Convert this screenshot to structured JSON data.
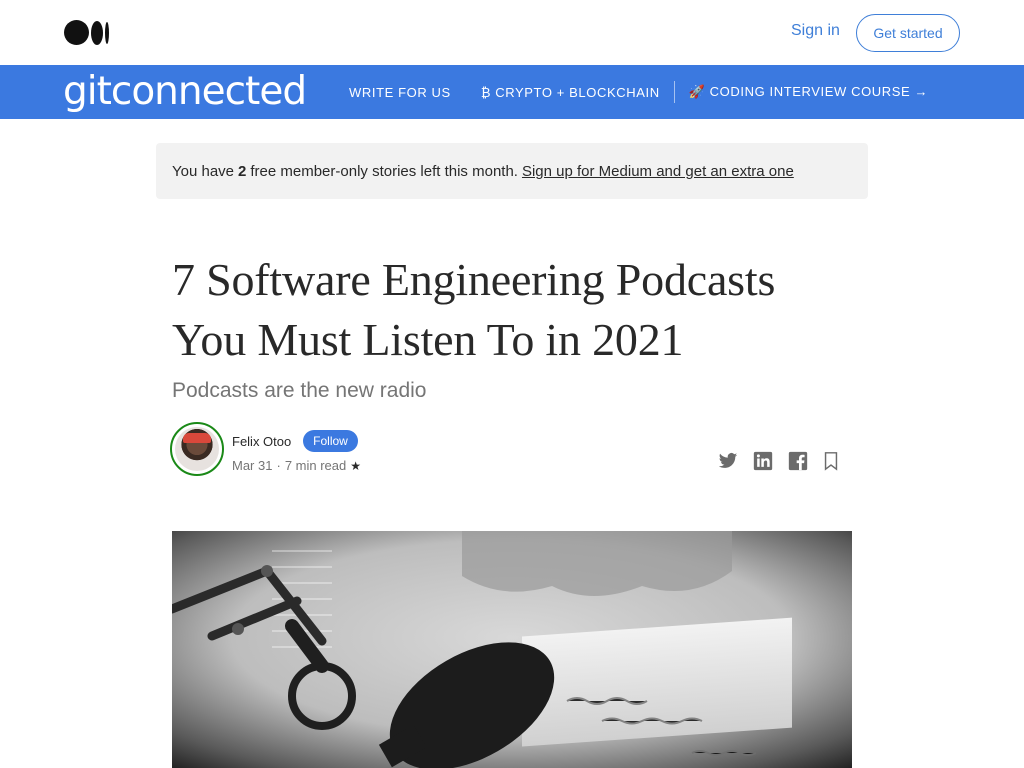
{
  "topbar": {
    "signin_label": "Sign in",
    "getstarted_label": "Get started"
  },
  "publication": {
    "logo_text": "gitconnected",
    "nav": [
      {
        "label": "WRITE FOR US"
      },
      {
        "label": "₿ CRYPTO + BLOCKCHAIN"
      },
      {
        "label": "🚀 CODING INTERVIEW COURSE →"
      }
    ]
  },
  "banner": {
    "prefix": "You have",
    "count": "2",
    "suffix": "free member-only stories left this month.",
    "link": "Sign up for Medium and get an extra one"
  },
  "article": {
    "title_line1": "7 Software Engineering Podcasts",
    "title_line2": "You Must Listen To in 2021",
    "subtitle": "Podcasts are the new radio",
    "author": "Felix Otoo",
    "follow_label": "Follow",
    "date": "Mar 31",
    "read_time": "7 min read",
    "member_star": "★"
  },
  "icons": {
    "share": [
      "twitter-icon",
      "linkedin-icon",
      "facebook-icon",
      "bookmark-icon"
    ]
  },
  "colors": {
    "brand_blue": "#3b79e0",
    "link_blue": "#3f7fd8",
    "avatar_ring": "#1a8917"
  }
}
